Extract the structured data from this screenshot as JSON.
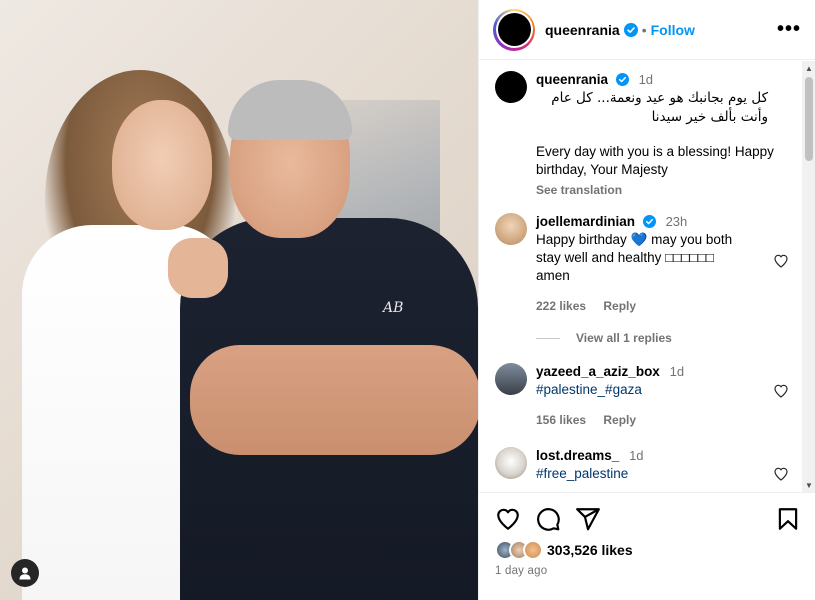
{
  "post": {
    "username": "queenrania",
    "separator": "•",
    "follow_label": "Follow",
    "more_label": "•••"
  },
  "caption": {
    "username": "queenrania",
    "time": "1d",
    "arabic_text": "كل يوم بجانبك هو عيد ونعمة... كل عام وأنت بألف خير سيدنا",
    "english_text": "Every day with you is a blessing! Happy birthday, Your Majesty",
    "see_translation": "See translation"
  },
  "comments": [
    {
      "username": "joellemardinian",
      "time": "23h",
      "text": "Happy birthday 💙 may you both stay well and healthy □□□□□□ amen",
      "likes": "222 likes",
      "reply": "Reply",
      "view_replies": "View all 1 replies",
      "verified": true
    },
    {
      "username": "yazeed_a_aziz_box",
      "time": "1d",
      "text": "#palestine_#gaza",
      "likes": "156 likes",
      "reply": "Reply"
    },
    {
      "username": "lost.dreams_",
      "time": "1d",
      "text": "#free_palestine"
    }
  ],
  "engagement": {
    "likes": "303,526 likes",
    "time_ago": "1 day ago"
  },
  "photo": {
    "shirt_logo": "AB"
  },
  "icons": {
    "verified": "verified-badge-icon",
    "heart": "heart-icon",
    "comment": "comment-icon",
    "share": "share-icon",
    "save": "bookmark-icon",
    "tag": "user-tag-icon",
    "accent": "#0095f6"
  }
}
